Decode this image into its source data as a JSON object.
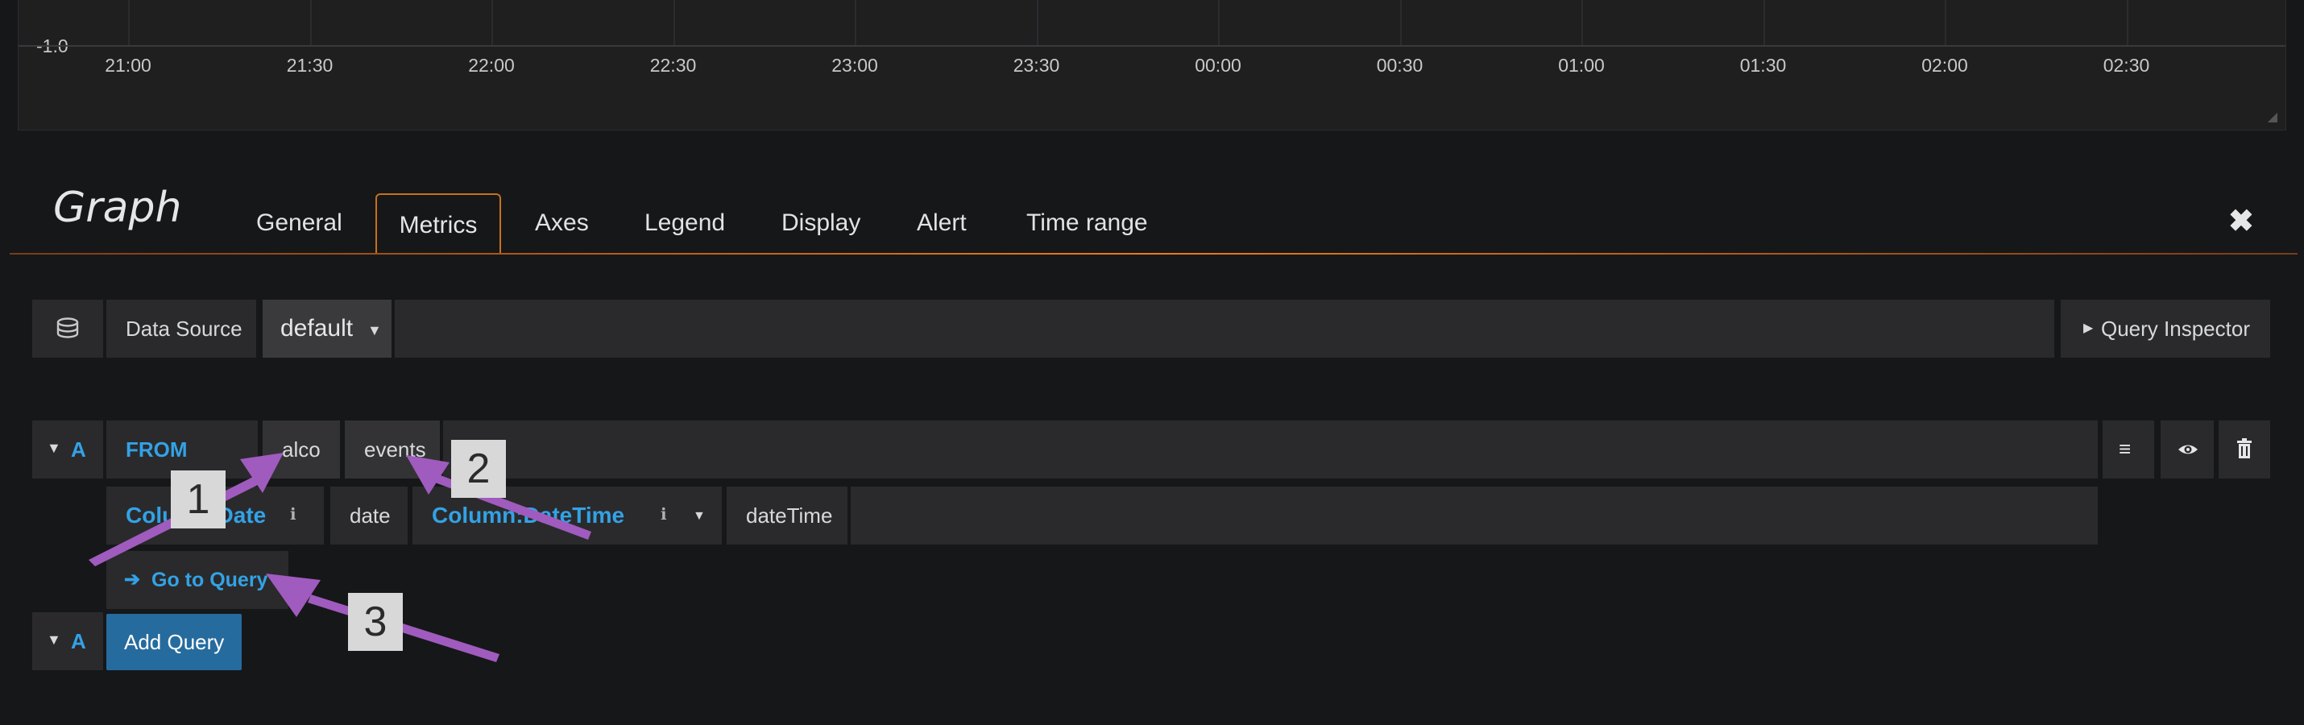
{
  "graph": {
    "y_tick": "-1.0",
    "x_ticks": [
      "21:00",
      "21:30",
      "22:00",
      "22:30",
      "23:00",
      "23:30",
      "00:00",
      "00:30",
      "01:00",
      "01:30",
      "02:00",
      "02:30"
    ]
  },
  "editor": {
    "title": "Graph",
    "tabs": [
      "General",
      "Metrics",
      "Axes",
      "Legend",
      "Display",
      "Alert",
      "Time range"
    ],
    "active_tab": "Metrics",
    "close_symbol": "✖"
  },
  "datasource": {
    "label": "Data Source",
    "value": "default",
    "inspector_label": "Query Inspector"
  },
  "query": {
    "ref": "A",
    "from_label": "FROM",
    "database": "alco",
    "table": "events",
    "date_column_label": "Column:Date",
    "date_value": "date",
    "datetime_column_label": "Column:DateTime",
    "datetime_value": "dateTime",
    "goto_label": "Go to Query"
  },
  "add_query": {
    "ref": "A",
    "label": "Add Query"
  },
  "annotations": {
    "badges": [
      "1",
      "2",
      "3"
    ],
    "arrow_color": "#a05bbe"
  }
}
